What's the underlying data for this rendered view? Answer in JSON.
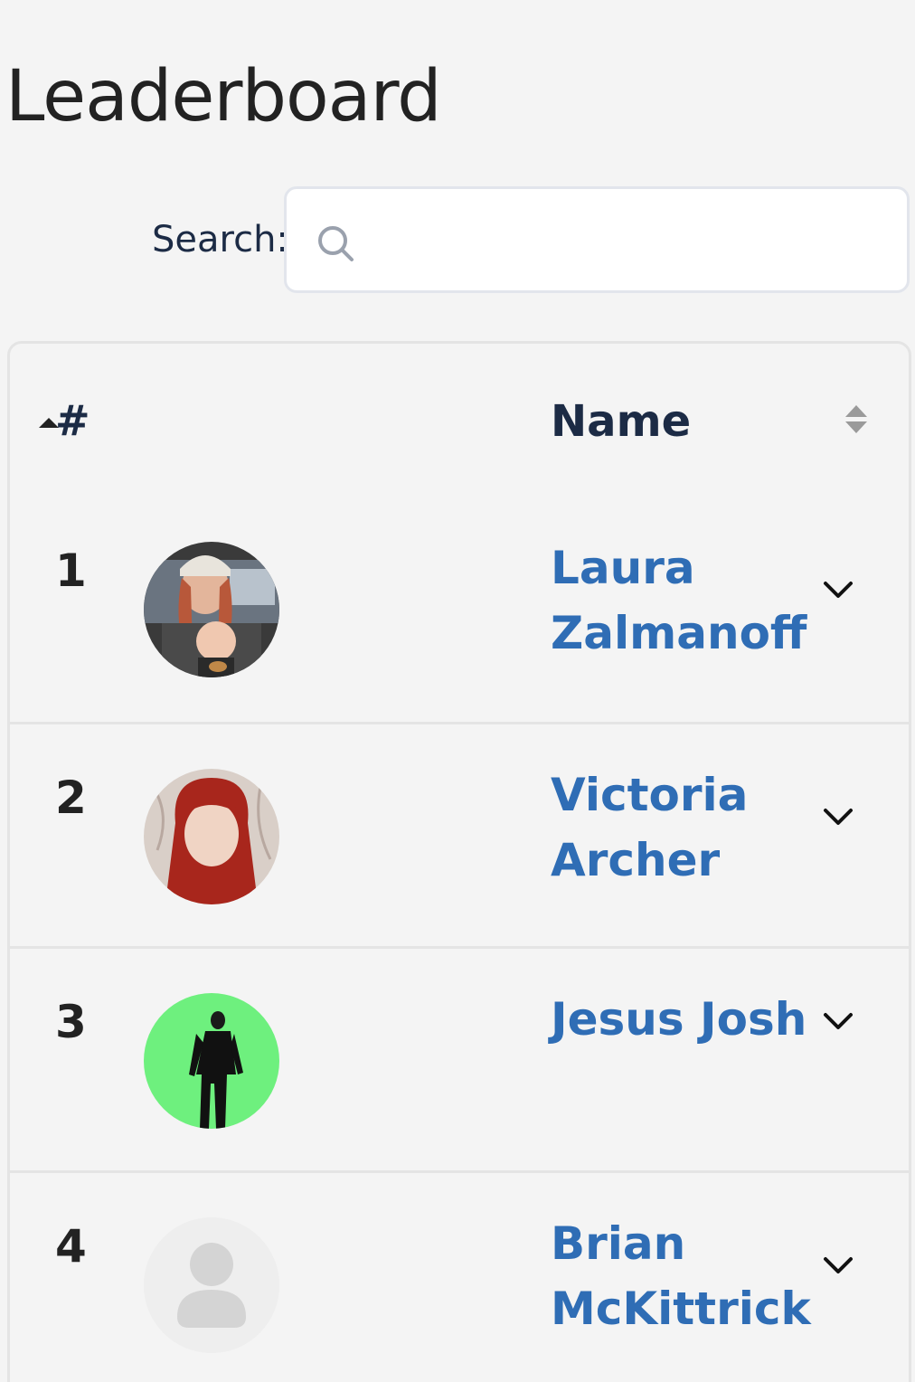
{
  "page": {
    "title": "Leaderboard"
  },
  "search": {
    "label": "Search:",
    "value": "",
    "placeholder": ""
  },
  "table": {
    "columns": {
      "rank": "#",
      "name": "Name"
    },
    "rows": [
      {
        "rank": "1",
        "name": "Laura Zalmanoff",
        "avatar": "photo-woman-with-baby"
      },
      {
        "rank": "2",
        "name": "Victoria Archer",
        "avatar": "photo-red-hair-woman"
      },
      {
        "rank": "3",
        "name": "Jesus Josh",
        "avatar": "photo-man-green-screen"
      },
      {
        "rank": "4",
        "name": "Brian McKittrick",
        "avatar": "default-user-icon"
      }
    ]
  },
  "colors": {
    "background": "#f4f4f4",
    "link": "#2f6db5",
    "heading": "#1c2b45",
    "border": "#e4e4e4"
  }
}
